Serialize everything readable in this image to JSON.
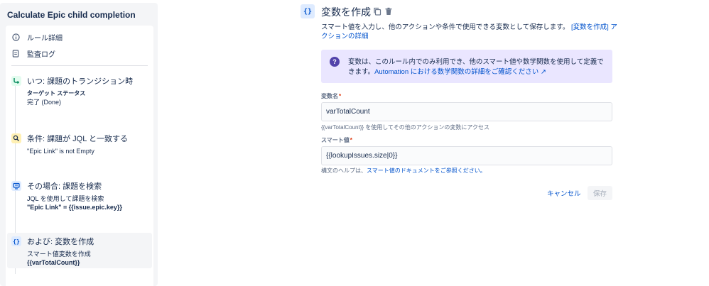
{
  "sidebar": {
    "title": "Calculate Epic child completion",
    "nav": [
      {
        "label": "ルール詳細",
        "icon": "info-icon"
      },
      {
        "label": "監査ログ",
        "icon": "audit-log-icon"
      }
    ],
    "steps": [
      {
        "title": "いつ: 課題のトランジション時",
        "icon": "transition-icon",
        "icon_color": "#36b37e",
        "sub_label": "ターゲット ステータス",
        "detail": "完了 (Done)"
      },
      {
        "title": "条件: 課題が JQL と一致する",
        "icon": "search-icon",
        "icon_color": "#ffc400",
        "line1": "\"Epic Link\" is not Empty"
      },
      {
        "title": "その場合: 課題を検索",
        "icon": "lookup-icon",
        "icon_color": "#0065ff",
        "line1": "JQL を使用して課題を検索",
        "line2": "\"Epic Link\" = {{issue.epic.key}}"
      },
      {
        "title": "および: 変数を作成",
        "icon": "variable-icon",
        "icon_color": "#0052cc",
        "line1": "スマート値変数を作成",
        "line2": "{{varTotalCount}}"
      }
    ]
  },
  "main": {
    "header_icon": "{}",
    "title": "変数を作成",
    "description": "スマート値を入力し、他のアクションや条件で使用できる変数として保存します。",
    "description_link": "[変数を作成] アクションの詳細",
    "info_panel": {
      "text": "変数は、このルール内でのみ利用でき、他のスマート値や数学関数を使用して定義できます。",
      "link": "Automation における数学関数の詳細をご確認ください ↗"
    },
    "variable_name": {
      "label": "変数名",
      "required_mark": "*",
      "value": "varTotalCount",
      "help": "{{varTotalCount}} を使用してその他のアクションの変数にアクセス"
    },
    "smart_value": {
      "label": "スマート値",
      "required_mark": "*",
      "value": "{{lookupIssues.size|0}}",
      "help_prefix": "構文のヘルプは、",
      "help_link": "スマート値のドキュメントをご参照ください。"
    },
    "cancel_label": "キャンセル",
    "save_label": "保存"
  },
  "colors": {
    "link": "#0052cc",
    "info_panel_bg": "#eae6ff",
    "info_icon": "#5243aa",
    "required": "#de350b"
  }
}
